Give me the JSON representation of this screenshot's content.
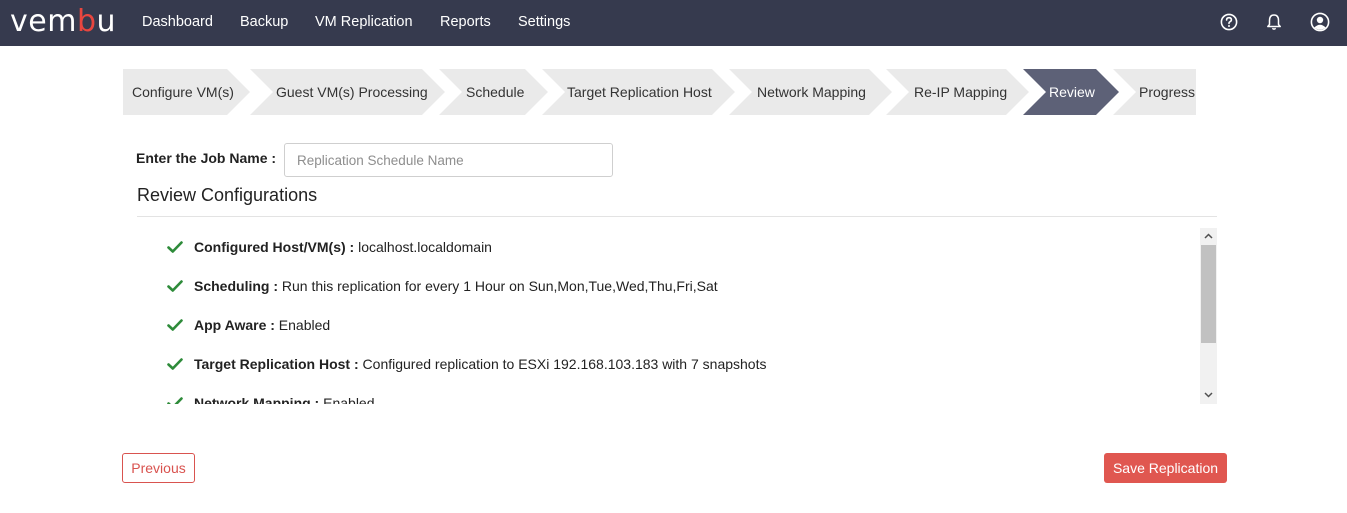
{
  "brand": {
    "logo_prefix": "vem",
    "logo_accent": "b",
    "logo_suffix": "u",
    "accent_color": "#e8463f",
    "nav_bg": "#363a4e"
  },
  "nav": {
    "items": [
      {
        "label": "Dashboard"
      },
      {
        "label": "Backup"
      },
      {
        "label": "VM Replication"
      },
      {
        "label": "Reports"
      },
      {
        "label": "Settings"
      }
    ],
    "icons": [
      "help-circle-icon",
      "bell-icon",
      "user-account-icon"
    ]
  },
  "wizard": {
    "steps": [
      {
        "label": "Configure VM(s)",
        "active": false
      },
      {
        "label": "Guest VM(s) Processing",
        "active": false
      },
      {
        "label": "Schedule",
        "active": false
      },
      {
        "label": "Target Replication Host",
        "active": false
      },
      {
        "label": "Network Mapping",
        "active": false
      },
      {
        "label": "Re-IP Mapping",
        "active": false
      },
      {
        "label": "Review",
        "active": true
      },
      {
        "label": "Progress",
        "active": false
      }
    ],
    "active_color": "#5d6177"
  },
  "job": {
    "label": "Enter the Job Name :",
    "value": "",
    "placeholder": "Replication Schedule Name"
  },
  "review": {
    "title": "Review Configurations",
    "items": [
      {
        "key": "Configured Host/VM(s) :",
        "value": "localhost.localdomain",
        "icon": "check-icon"
      },
      {
        "key": "Scheduling :",
        "value": "Run this replication for every 1 Hour on Sun,Mon,Tue,Wed,Thu,Fri,Sat",
        "icon": "check-icon"
      },
      {
        "key": "App Aware :",
        "value": "Enabled",
        "icon": "check-icon"
      },
      {
        "key": "Target Replication Host :",
        "value": "Configured replication to ESXi 192.168.103.183 with 7 snapshots",
        "icon": "check-icon"
      },
      {
        "key": "Network Mapping :",
        "value": "Enabled",
        "icon": "check-icon"
      }
    ],
    "check_color": "#2e8b3a"
  },
  "actions": {
    "previous_label": "Previous",
    "save_label": "Save Replication"
  }
}
